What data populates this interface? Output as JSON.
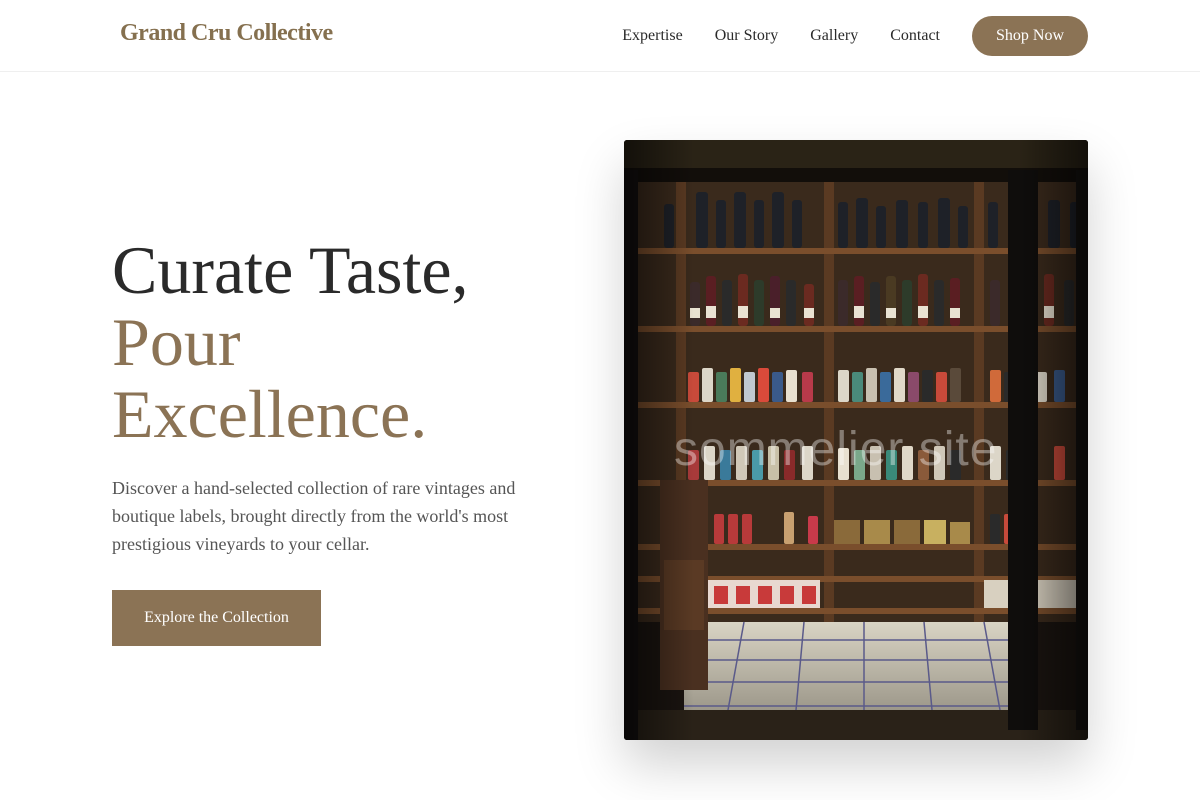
{
  "header": {
    "logo": "Grand Cru Collective",
    "nav": [
      "Expertise",
      "Our Story",
      "Gallery",
      "Contact"
    ],
    "shop_label": "Shop Now"
  },
  "hero": {
    "title_line1": "Curate Taste,",
    "title_line2": "Pour",
    "title_line3": "Excellence.",
    "description": "Discover a hand-selected collection of rare vintages and boutique labels, brought directly from the world's most prestigious vineyards to your cellar.",
    "cta_label": "Explore the Collection",
    "image_watermark": "sommelier site"
  },
  "colors": {
    "accent": "#8b7355",
    "text": "#2a2a2a",
    "muted": "#555555"
  }
}
